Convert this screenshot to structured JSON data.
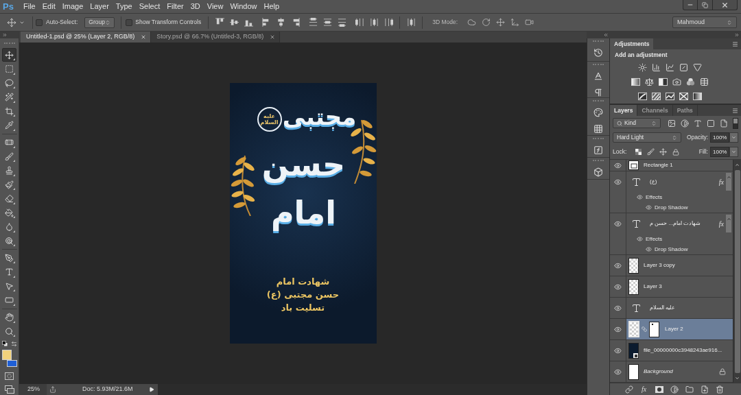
{
  "app": {
    "logo": "Ps"
  },
  "menu": [
    "File",
    "Edit",
    "Image",
    "Layer",
    "Type",
    "Select",
    "Filter",
    "3D",
    "View",
    "Window",
    "Help"
  ],
  "options_bar": {
    "auto_select": {
      "label": "Auto-Select:",
      "checked": false
    },
    "auto_select_target": "Group",
    "transform_controls": {
      "label": "Show Transform Controls",
      "checked": false
    },
    "mode_label": "3D Mode:",
    "workspace": "Mahmoud"
  },
  "document_tabs": [
    {
      "title": "Untitled-1.psd @ 25% (Layer 2, RGB/8)",
      "selected": true
    },
    {
      "title": "Story.psd @ 66.7% (Untitled-3, RGB/8)",
      "selected": false
    }
  ],
  "toolbar": {
    "tool_groups": [
      [
        {
          "kind": "move",
          "selected": true
        },
        {
          "kind": "marquee",
          "selected": false
        },
        {
          "kind": "lasso",
          "selected": false
        },
        {
          "kind": "wand",
          "selected": false
        },
        {
          "kind": "crop",
          "selected": false
        },
        {
          "kind": "eyedropper",
          "selected": false
        }
      ],
      [
        {
          "kind": "healing",
          "selected": false
        },
        {
          "kind": "brush",
          "selected": false
        },
        {
          "kind": "stamp",
          "selected": false
        },
        {
          "kind": "history",
          "selected": false
        },
        {
          "kind": "eraser",
          "selected": false
        },
        {
          "kind": "bucket",
          "selected": false
        },
        {
          "kind": "blur",
          "selected": false
        },
        {
          "kind": "dodge",
          "selected": false
        }
      ],
      [
        {
          "kind": "pen",
          "selected": false
        },
        {
          "kind": "type",
          "selected": false
        },
        {
          "kind": "select",
          "selected": false
        },
        {
          "kind": "shape",
          "selected": false
        }
      ],
      [
        {
          "kind": "hand",
          "selected": false
        },
        {
          "kind": "zoom",
          "selected": false
        }
      ]
    ],
    "color_swatches": [
      {
        "kind": "foreground",
        "color": "#f2d27c"
      },
      {
        "kind": "background",
        "color": "#1f5fd6"
      }
    ]
  },
  "canvas": {
    "badge_text": "علیه السلام",
    "calligraphy": [
      "مجتبی",
      "حسن",
      "امام"
    ],
    "caption": [
      "شهادت امام",
      "حسن مجتبی (ع)",
      "تسلیت باد"
    ]
  },
  "status_bar": {
    "zoom": "25%",
    "doc_info": "Doc: 5.93M/21.6M"
  },
  "adjustments_panel": {
    "tab": "Adjustments",
    "heading": "Add an adjustment"
  },
  "layers_panel": {
    "tabs": [
      {
        "label": "Layers",
        "selected": true
      },
      {
        "label": "Channels",
        "selected": false
      },
      {
        "label": "Paths",
        "selected": false
      }
    ],
    "filter": "Kind",
    "filter_on": false,
    "blend_mode": "Hard Light",
    "opacity_label": "Opacity:",
    "opacity": "100%",
    "lock_label": "Lock:",
    "fill_label": "Fill:",
    "fill": "100%",
    "layers": [
      {
        "kind": "shape",
        "name": "Rectangle 1",
        "visible": true,
        "selected": false,
        "locked": false
      },
      {
        "kind": "text",
        "name": "(ع)",
        "visible": true,
        "selected": false,
        "locked": false,
        "fx": "fx",
        "expanded": true,
        "effects": {
          "label": "Effects",
          "items": [
            "Drop Shadow"
          ]
        }
      },
      {
        "kind": "text",
        "name": "شهادت امام... حسن م",
        "visible": true,
        "selected": false,
        "locked": false,
        "fx": "fx",
        "expanded": true,
        "effects": {
          "label": "Effects",
          "items": [
            "Drop Shadow"
          ]
        }
      },
      {
        "kind": "pixel",
        "name": "Layer 3 copy",
        "visible": true,
        "selected": false,
        "locked": false
      },
      {
        "kind": "pixel",
        "name": "Layer 3",
        "visible": true,
        "selected": false,
        "locked": false
      },
      {
        "kind": "text",
        "name": "علیه السلام",
        "visible": true,
        "selected": false,
        "locked": false
      },
      {
        "kind": "masked",
        "name": "Layer 2",
        "visible": true,
        "selected": true,
        "locked": false
      },
      {
        "kind": "smart",
        "name": "file_00000000c3948243ae916...",
        "visible": true,
        "selected": false,
        "locked": false
      },
      {
        "kind": "background",
        "name": "Background",
        "visible": true,
        "selected": false,
        "locked": true
      }
    ],
    "footer_fx": "fx"
  }
}
